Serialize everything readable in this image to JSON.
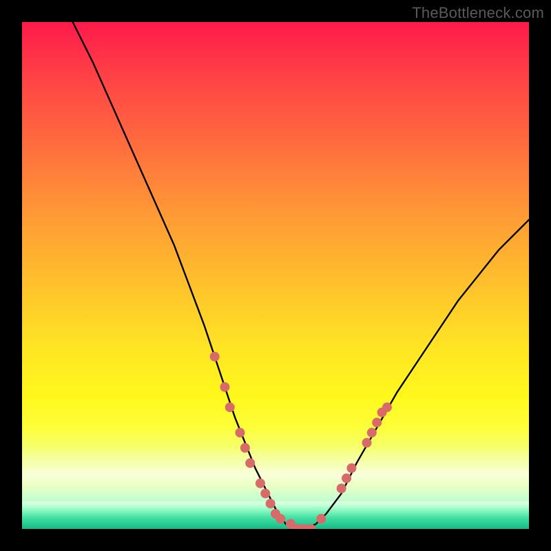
{
  "watermark": "TheBottleneck.com",
  "chart_data": {
    "type": "line",
    "title": "",
    "xlabel": "",
    "ylabel": "",
    "xlim": [
      0,
      100
    ],
    "ylim": [
      0,
      100
    ],
    "series": [
      {
        "name": "bottleneck-curve",
        "x": [
          10,
          14,
          18,
          22,
          26,
          30,
          33,
          36,
          38,
          40,
          42,
          44,
          46,
          48,
          50,
          52,
          54,
          56,
          58,
          60,
          63,
          66,
          70,
          74,
          78,
          82,
          86,
          90,
          94,
          98,
          100
        ],
        "y": [
          100,
          92,
          83,
          74,
          65,
          56,
          48,
          40,
          34,
          28,
          22,
          17,
          12,
          8,
          4,
          1,
          0,
          0,
          1,
          3,
          7,
          13,
          20,
          27,
          33,
          39,
          45,
          50,
          55,
          59,
          61
        ]
      }
    ],
    "markers": {
      "name": "highlight-points",
      "color": "#d86a6a",
      "radius_px": 7,
      "points": [
        {
          "x": 38,
          "y": 34
        },
        {
          "x": 40,
          "y": 28
        },
        {
          "x": 41,
          "y": 24
        },
        {
          "x": 43,
          "y": 19
        },
        {
          "x": 44,
          "y": 16
        },
        {
          "x": 45,
          "y": 13
        },
        {
          "x": 47,
          "y": 9
        },
        {
          "x": 48,
          "y": 7
        },
        {
          "x": 49,
          "y": 5
        },
        {
          "x": 50,
          "y": 3
        },
        {
          "x": 51,
          "y": 2
        },
        {
          "x": 53,
          "y": 1
        },
        {
          "x": 54,
          "y": 0
        },
        {
          "x": 55,
          "y": 0
        },
        {
          "x": 56,
          "y": 0
        },
        {
          "x": 57,
          "y": 0
        },
        {
          "x": 59,
          "y": 2
        },
        {
          "x": 63,
          "y": 8
        },
        {
          "x": 64,
          "y": 10
        },
        {
          "x": 65,
          "y": 12
        },
        {
          "x": 68,
          "y": 17
        },
        {
          "x": 69,
          "y": 19
        },
        {
          "x": 70,
          "y": 21
        },
        {
          "x": 71,
          "y": 23
        },
        {
          "x": 72,
          "y": 24
        }
      ]
    }
  }
}
